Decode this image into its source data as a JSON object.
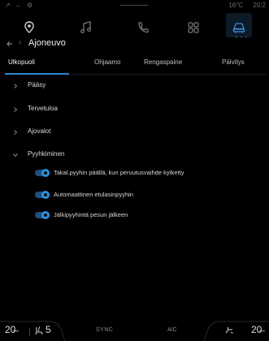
{
  "status": {
    "left_icons": "↗ ← ⚙",
    "temperature": "16°C",
    "time": "20:2"
  },
  "header": {
    "title": "Ajoneuvo"
  },
  "tabs": [
    {
      "label": "Ulkopuoli",
      "active": true
    },
    {
      "label": "Ohjaamo",
      "active": false
    },
    {
      "label": "Rengaspaine",
      "active": false
    },
    {
      "label": "Päivitys",
      "active": false
    }
  ],
  "menu": {
    "items": [
      {
        "label": "Pääsy",
        "expanded": false
      },
      {
        "label": "Tervetuloa",
        "expanded": false
      },
      {
        "label": "Ajovalot",
        "expanded": false
      },
      {
        "label": "Pyyhkiminen",
        "expanded": true
      }
    ],
    "wiper_options": [
      {
        "label": "Takal.pyyhin päällä, kun peruutusvaihde kytketty",
        "on": true
      },
      {
        "label": "Automaattinen etulasinpyyhin",
        "on": true
      },
      {
        "label": "Jälkipyyhintä pesun jälkeen",
        "on": true
      }
    ]
  },
  "bottom": {
    "temp_left": "20̶",
    "seat_level": "5",
    "sync_label": "SYNC",
    "ac_label": "A/C",
    "temp_right": "20̶"
  },
  "colors": {
    "accent": "#2f86cf",
    "background": "#000000",
    "toggle_track": "#1f4f7c"
  }
}
